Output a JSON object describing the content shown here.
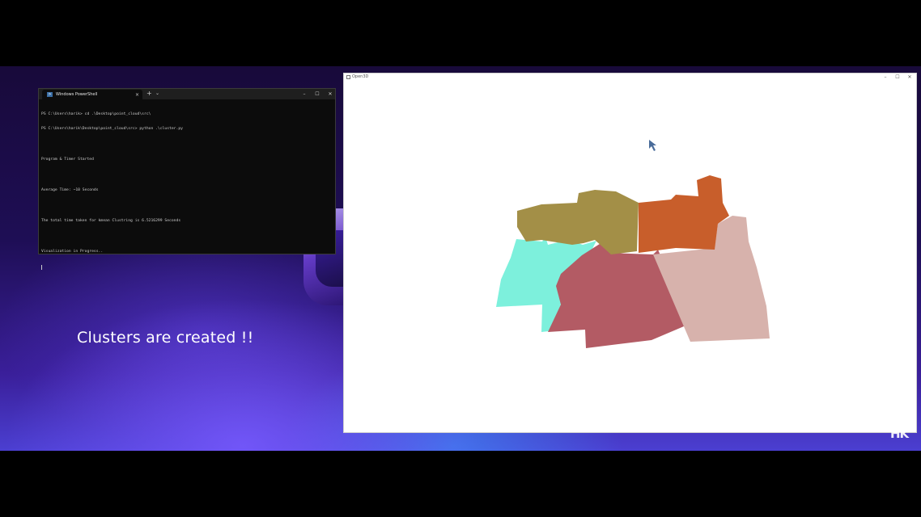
{
  "terminal": {
    "tab_title": "Windows PowerShell",
    "tab_close": "×",
    "new_tab": "+",
    "dropdown": "⌄",
    "minimize": "–",
    "maximize": "☐",
    "close": "✕",
    "lines": [
      "PS C:\\Users\\harik> cd .\\Desktop\\point_cloud\\src\\",
      "PS C:\\Users\\harik\\Desktop\\point_cloud\\src> python .\\cluster.py",
      "",
      "Program & Timer Started",
      "",
      "Average Time: ~10 Seconds",
      "",
      "The total time taken for kmean Clustring is 6.5216299 Seconds",
      "",
      "Visualization in Progress.."
    ]
  },
  "open3d": {
    "title": "Open3D",
    "minimize": "–",
    "maximize": "☐",
    "close": "✕",
    "cluster_colors": {
      "olive": "#a38f47",
      "orange": "#c85e2b",
      "aqua": "#7df0dc",
      "rose": "#b35b64",
      "pink": "#d7b2ac"
    }
  },
  "caption": "Clusters are created !!",
  "watermark": "HK"
}
